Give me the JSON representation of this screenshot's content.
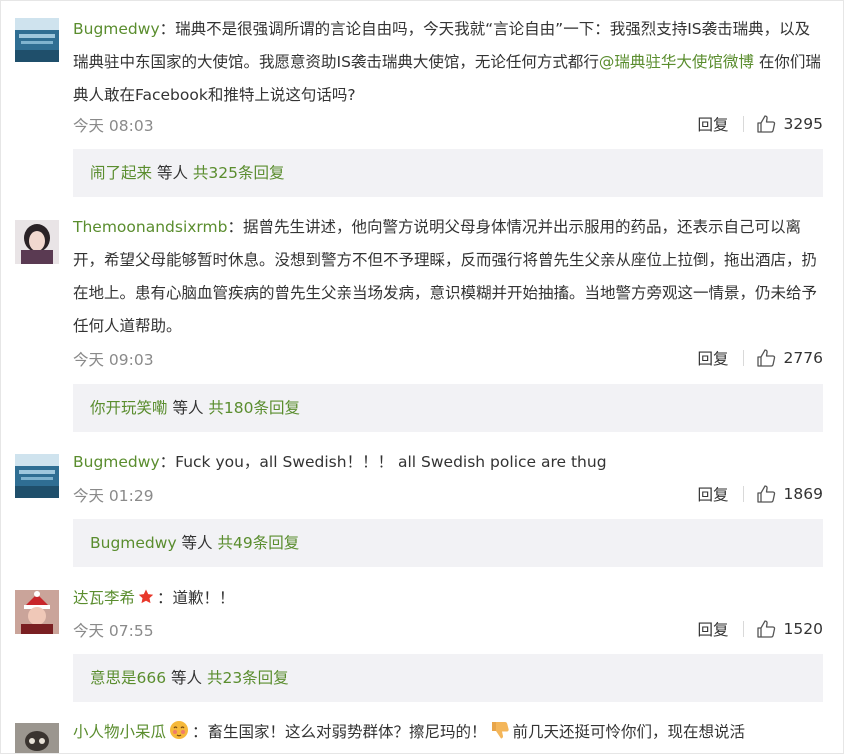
{
  "comments": [
    {
      "username": "Bugmedwy",
      "text_a": "瑞典不是很强调所谓的言论自由吗，今天我就“言论自由”一下：我强烈支持IS袭击瑞典，以及瑞典驻中东国家的大使馆。我愿意资助IS袭击瑞典大使馆，无论任何方式都行",
      "mention": "@瑞典驻华大使馆微博",
      "text_b": " 在你们瑞典人敢在Facebook和推特上说这句话吗?",
      "time": "今天 08:03",
      "reply_label": "回复",
      "likes": "3295",
      "reply_user": "闹了起来",
      "reply_mid": " 等人 ",
      "reply_count": "共325条回复"
    },
    {
      "username": "Themoonandsixrmb",
      "text": "据曾先生讲述，他向警方说明父母身体情况并出示服用的药品，还表示自己可以离开，希望父母能够暂时休息。没想到警方不但不予理睬，反而强行将曾先生父亲从座位上拉倒，拖出酒店，扔在地上。患有心脑血管疾病的曾先生父亲当场发病，意识模糊并开始抽搐。当地警方旁观这一情景，仍未给予任何人道帮助。",
      "time": "今天 09:03",
      "reply_label": "回复",
      "likes": "2776",
      "reply_user": "你开玩笑嘞",
      "reply_mid": " 等人 ",
      "reply_count": "共180条回复"
    },
    {
      "username": "Bugmedwy",
      "text": "Fuck you，all Swedish！！！ all Swedish police are thug",
      "time": "今天 01:29",
      "reply_label": "回复",
      "likes": "1869",
      "reply_user": "Bugmedwy",
      "reply_mid": " 等人 ",
      "reply_count": "共49条回复"
    },
    {
      "username": "达瓦李希",
      "text": "道歉！！",
      "time": "今天 07:55",
      "reply_label": "回复",
      "likes": "1520",
      "reply_user": "意思是666",
      "reply_mid": " 等人 ",
      "reply_count": "共23条回复"
    },
    {
      "username": "小人物小呆瓜",
      "text_a": "畜生国家！这么对弱势群体？擦尼玛的！",
      "text_b": "前几天还挺可怜你们，现在想说活"
    }
  ],
  "colors": {
    "link": "#5a8d2e",
    "reply_bg": "#f2f2f5",
    "meta": "#8a8a8a"
  },
  "icons": {
    "like": "thumbs-up-icon",
    "badge_star": "star-badge-icon",
    "emoji_blush": "blush-emoji-icon",
    "emoji_thumbs_down": "thumbs-down-emoji-icon"
  },
  "colon": "："
}
